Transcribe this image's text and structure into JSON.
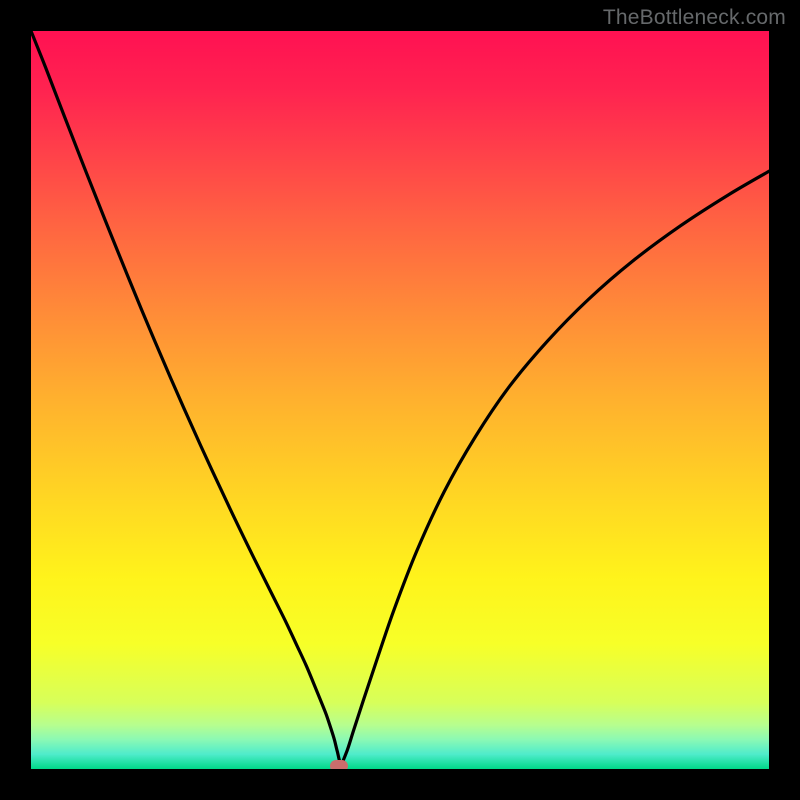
{
  "watermark": "TheBottleneck.com",
  "chart_data": {
    "type": "line",
    "title": "",
    "xlabel": "",
    "ylabel": "",
    "xlim": [
      0,
      1
    ],
    "ylim": [
      0,
      1
    ],
    "legend": false,
    "grid": false,
    "background_gradient": {
      "stops": [
        {
          "offset": 0.0,
          "color": "#ff1152"
        },
        {
          "offset": 0.08,
          "color": "#ff2350"
        },
        {
          "offset": 0.16,
          "color": "#ff3f4a"
        },
        {
          "offset": 0.26,
          "color": "#ff6342"
        },
        {
          "offset": 0.38,
          "color": "#ff8b38"
        },
        {
          "offset": 0.5,
          "color": "#ffb12e"
        },
        {
          "offset": 0.62,
          "color": "#ffd324"
        },
        {
          "offset": 0.74,
          "color": "#fff31b"
        },
        {
          "offset": 0.83,
          "color": "#f7ff28"
        },
        {
          "offset": 0.91,
          "color": "#d7ff5a"
        },
        {
          "offset": 0.94,
          "color": "#b7fe8e"
        },
        {
          "offset": 0.96,
          "color": "#8bf9b4"
        },
        {
          "offset": 0.98,
          "color": "#4feccb"
        },
        {
          "offset": 1.0,
          "color": "#00d888"
        }
      ]
    },
    "series": [
      {
        "name": "bottleneck-curve",
        "x": [
          0.0,
          0.02,
          0.045,
          0.075,
          0.11,
          0.15,
          0.19,
          0.23,
          0.27,
          0.3,
          0.325,
          0.345,
          0.36,
          0.373,
          0.383,
          0.392,
          0.4,
          0.406,
          0.411,
          0.415,
          0.42,
          0.428,
          0.437,
          0.45,
          0.468,
          0.492,
          0.523,
          0.56,
          0.602,
          0.648,
          0.7,
          0.755,
          0.815,
          0.88,
          0.945,
          1.0
        ],
        "y": [
          1.0,
          0.95,
          0.885,
          0.808,
          0.72,
          0.622,
          0.528,
          0.438,
          0.352,
          0.29,
          0.24,
          0.2,
          0.168,
          0.14,
          0.116,
          0.094,
          0.074,
          0.056,
          0.04,
          0.024,
          0.008,
          0.024,
          0.052,
          0.092,
          0.146,
          0.216,
          0.296,
          0.376,
          0.45,
          0.518,
          0.58,
          0.636,
          0.688,
          0.736,
          0.778,
          0.81
        ]
      }
    ],
    "marker": {
      "x": 0.418,
      "y": 0.004,
      "shape": "pill",
      "color": "#cb6d6c"
    }
  }
}
